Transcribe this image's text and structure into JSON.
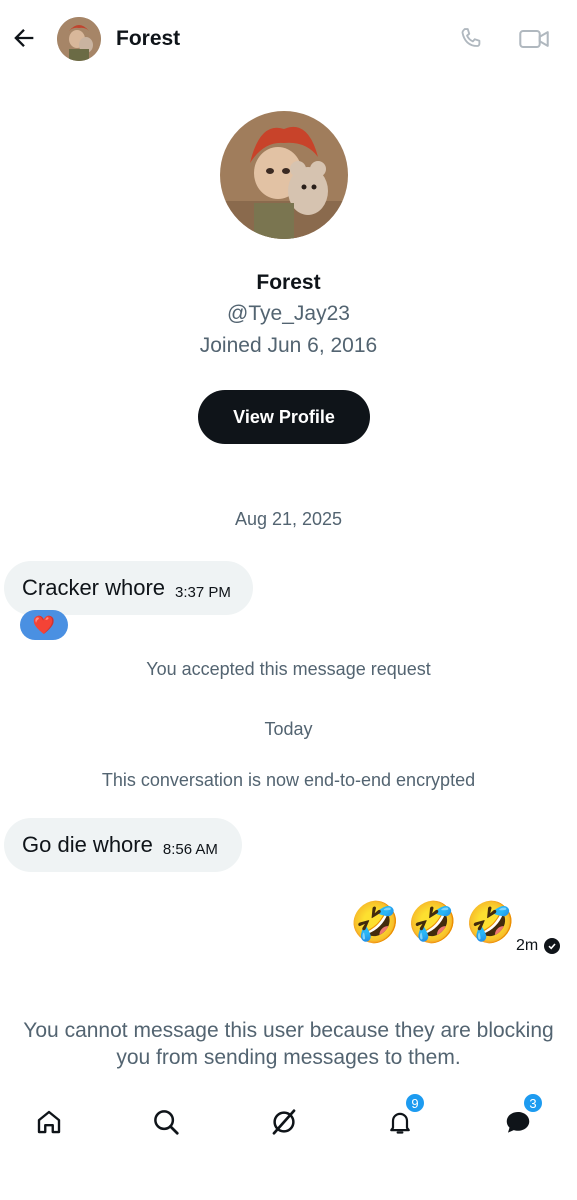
{
  "header": {
    "name": "Forest",
    "back_icon": "arrow-left-icon",
    "call_icon": "phone-icon",
    "video_icon": "video-camera-icon"
  },
  "profile": {
    "name": "Forest",
    "handle": "@Tye_Jay23",
    "joined": "Joined Jun 6, 2016",
    "view_profile_label": "View Profile"
  },
  "conversation": {
    "date_1": "Aug 21, 2025",
    "messages_received_1": {
      "text": "Cracker whore",
      "time": "3:37 PM",
      "reaction": "❤️"
    },
    "request_accepted": "You accepted this message request",
    "date_2": "Today",
    "encryption_notice": "This conversation is now end-to-end encrypted",
    "messages_received_2": {
      "text": "Go die whore",
      "time": "8:56 AM"
    },
    "messages_sent_1": {
      "emojis": [
        "🤣",
        "🤣",
        "🤣"
      ],
      "time": "2m"
    },
    "blocked_line_1": "You cannot message this user because they are blocking",
    "blocked_line_2": "you from sending messages to them."
  },
  "bottom_nav": {
    "items": [
      {
        "name": "home",
        "icon": "home-icon"
      },
      {
        "name": "search",
        "icon": "search-icon"
      },
      {
        "name": "grok",
        "icon": "grok-icon"
      },
      {
        "name": "notifications",
        "icon": "bell-icon",
        "badge": "9"
      },
      {
        "name": "messages",
        "icon": "messages-icon",
        "badge": "3"
      }
    ]
  },
  "colors": {
    "text_primary": "#0f1419",
    "text_secondary": "#536471",
    "bubble_bg": "#eff3f4",
    "badge_bg": "#1d9bf0",
    "reaction_bg": "#4a90e2"
  }
}
